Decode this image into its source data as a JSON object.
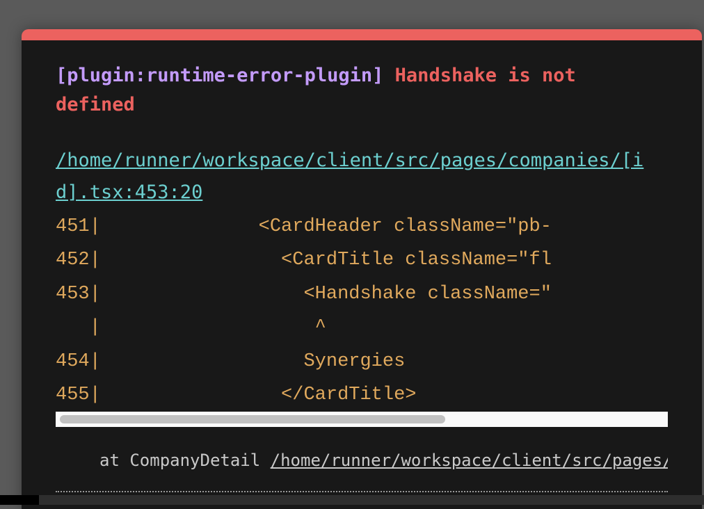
{
  "error": {
    "plugin": "[plugin:runtime-error-plugin]",
    "message": "Handshake is not defined",
    "file": "/home/runner/workspace/client/src/pages/companies/[id].tsx:453:20",
    "frame": [
      "451|              <CardHeader className=\"pb-",
      "452|                <CardTitle className=\"fl",
      "453|                  <Handshake className=\"",
      "   |                   ^",
      "454|                  Synergies",
      "455|                </CardTitle>"
    ],
    "stack_prefix": "at CompanyDetail ",
    "stack_link": "/home/runner/workspace/client/src/pages/companies/[id].tsx"
  },
  "colors": {
    "accent": "#ec625f",
    "plugin": "#c39bfa",
    "file": "#6ccfcf",
    "code": "#e0a95d",
    "background": "#181818"
  }
}
